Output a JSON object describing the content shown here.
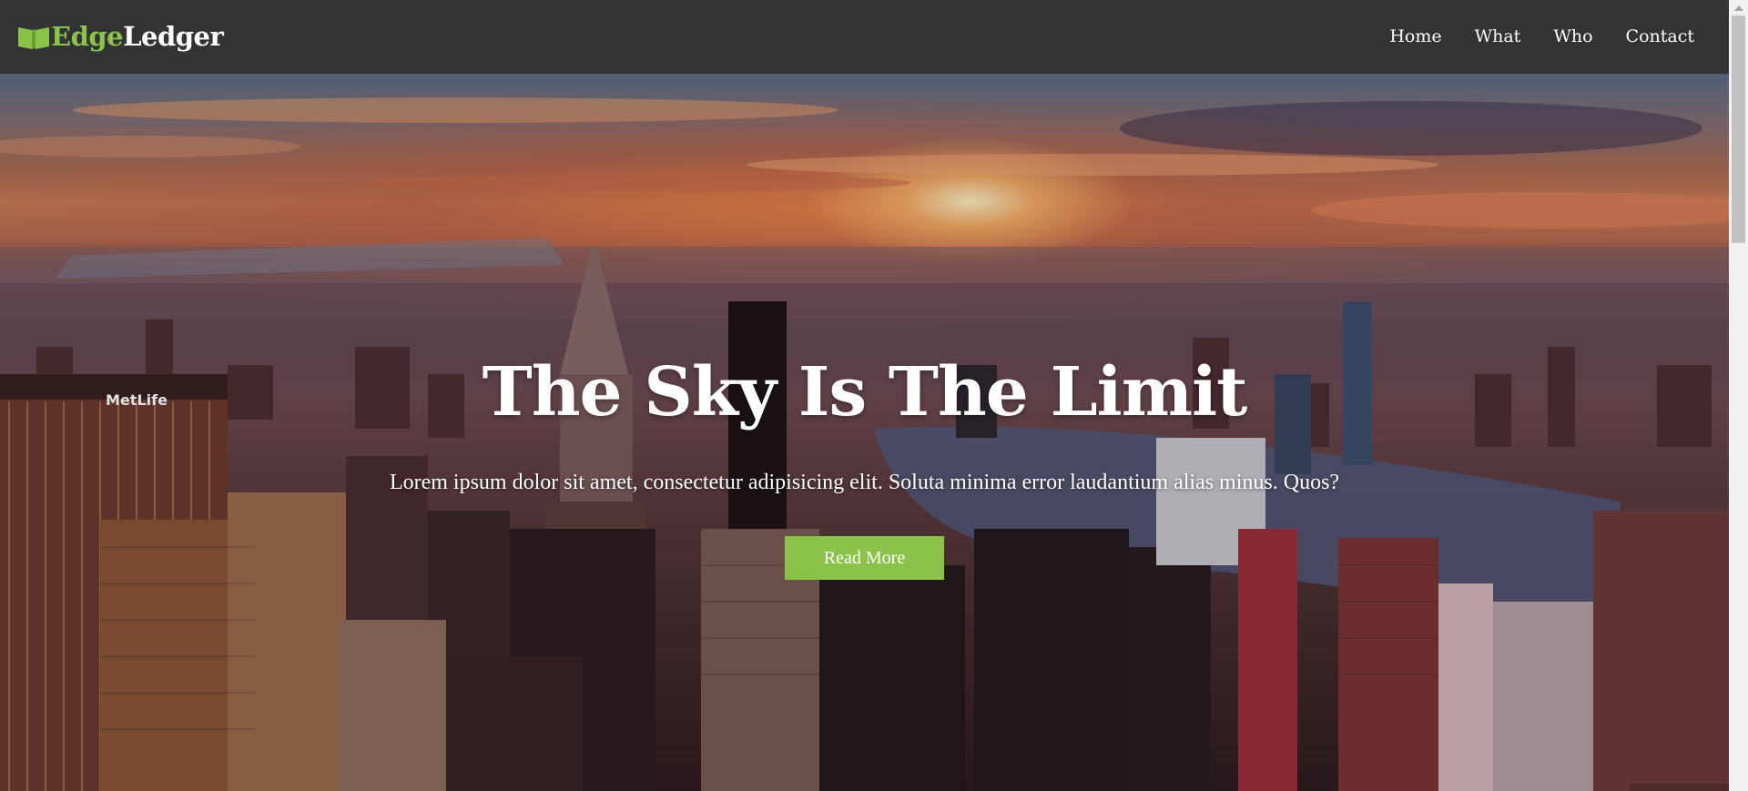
{
  "brand": {
    "part1": "Edge",
    "part2": "Ledger",
    "icon": "book-open-icon",
    "accent_color": "#8bc34a"
  },
  "nav": {
    "items": [
      {
        "label": "Home"
      },
      {
        "label": "What"
      },
      {
        "label": "Who"
      },
      {
        "label": "Contact"
      }
    ]
  },
  "hero": {
    "title": "The Sky Is The Limit",
    "subtitle": "Lorem ipsum dolor sit amet, consectetur adipisicing elit. Soluta minima error laudantium alias minus. Quos?",
    "button_label": "Read More",
    "background": "city-skyline-sunset-photo"
  },
  "colors": {
    "navbar_bg": "#333333",
    "button_bg": "#8bc34a",
    "text": "#ffffff"
  }
}
